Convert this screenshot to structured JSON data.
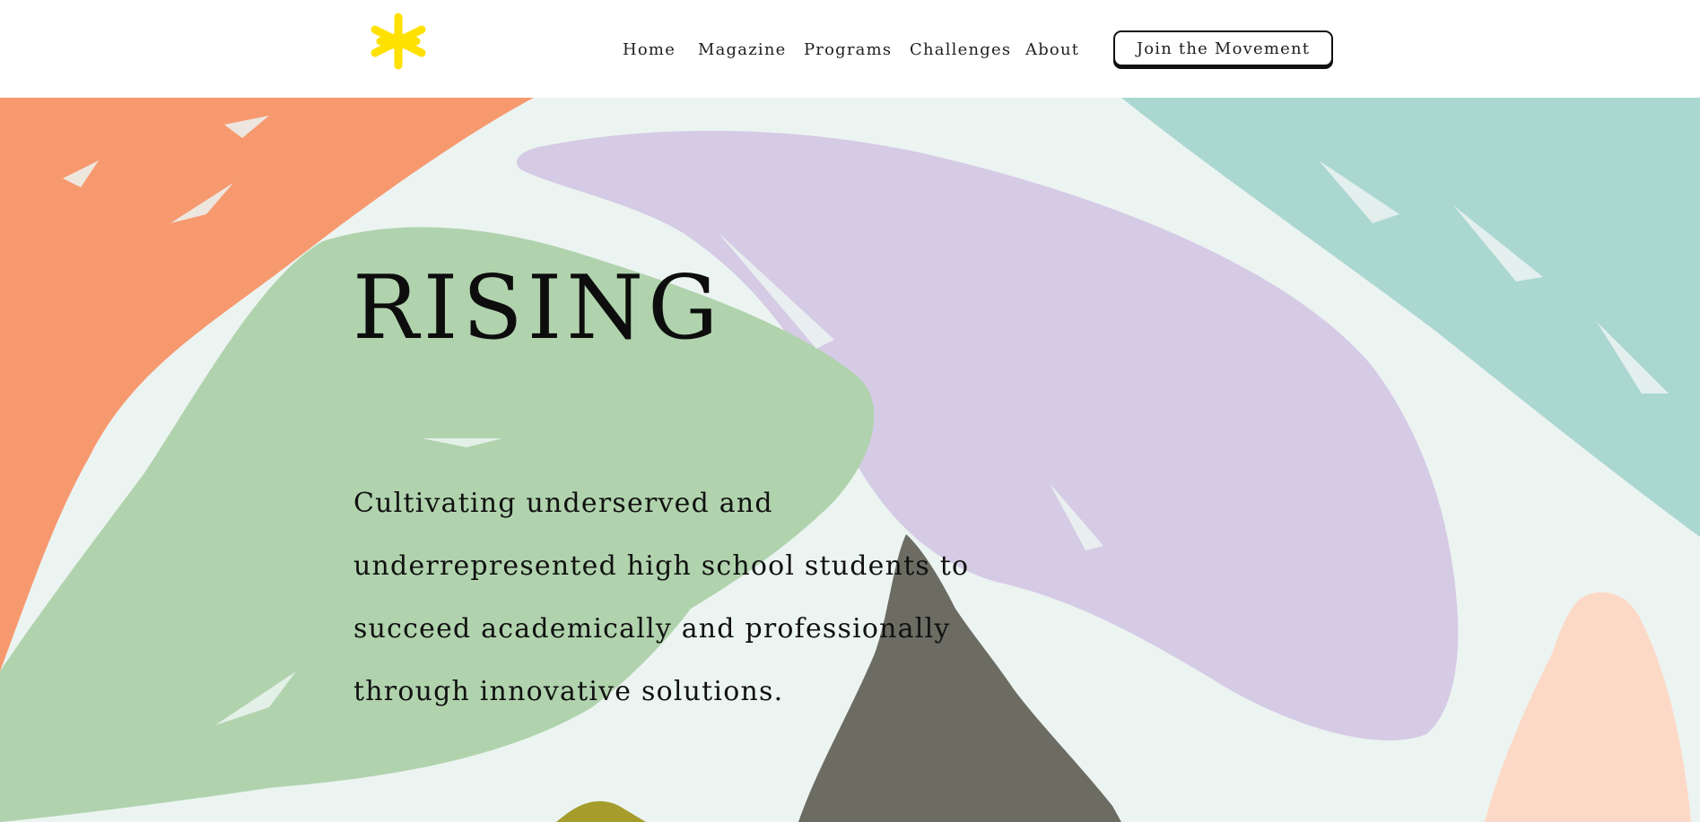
{
  "header": {
    "logo_icon": "yellow-asterisk-icon",
    "logo_color": "#ffe100",
    "nav": [
      {
        "label": "Home"
      },
      {
        "label": "Magazine"
      },
      {
        "label": "Programs"
      },
      {
        "label": "Challenges"
      },
      {
        "label": "About"
      }
    ],
    "cta_label": "Join the Movement"
  },
  "hero": {
    "title": "RISING",
    "description": "Cultivating underserved and underrepresented high school students to succeed academically and professionally through innovative solutions.",
    "background_color": "#ecf4f2",
    "shape_colors": {
      "orange": "#f7996f",
      "lavender": "#d5cbe5",
      "teal": "#abd7d1",
      "green": "#b0d3ad",
      "charcoal": "#6c6c63",
      "peach": "#fcd9c7",
      "olive": "#a59c2c"
    }
  }
}
